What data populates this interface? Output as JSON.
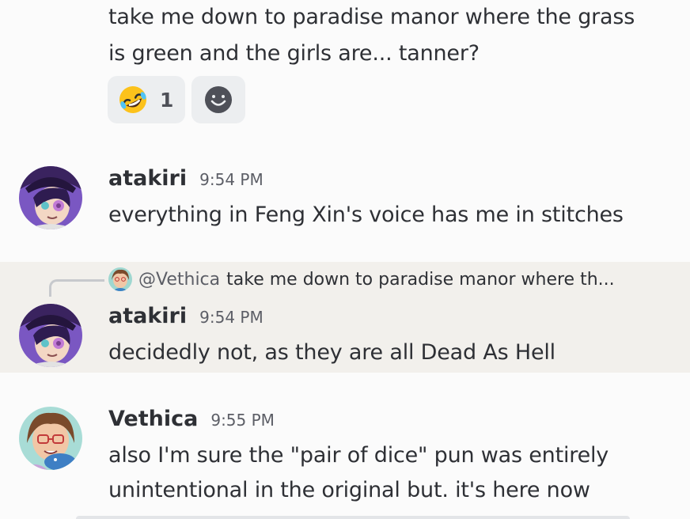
{
  "messages": {
    "first": {
      "line1": "take me down to paradise manor where the grass",
      "line2": "is green and the girls are... tanner?",
      "reaction": {
        "emoji_name": "rolling-on-floor-laughing-icon",
        "count": "1"
      },
      "add_reaction_icon": "smiley-add-reaction-icon"
    },
    "second": {
      "username": "atakiri",
      "time": "9:54 PM",
      "text": "everything in Feng Xin's voice has me in stitches"
    },
    "third": {
      "reply_user": "@Vethica",
      "reply_text": "take me down to paradise manor where th...",
      "username": "atakiri",
      "time": "9:54 PM",
      "text": "decidedly not, as they are all Dead As Hell"
    },
    "fourth": {
      "username": "Vethica",
      "time": "9:55 PM",
      "line1": "also I'm sure the \"pair of dice\" pun was entirely",
      "line2": "unintentional in the original but. it's here now"
    }
  },
  "colors": {
    "background": "#fbfbfb",
    "highlight": "#f2f0ec",
    "text": "#2e3035",
    "muted": "#5c5e66"
  }
}
